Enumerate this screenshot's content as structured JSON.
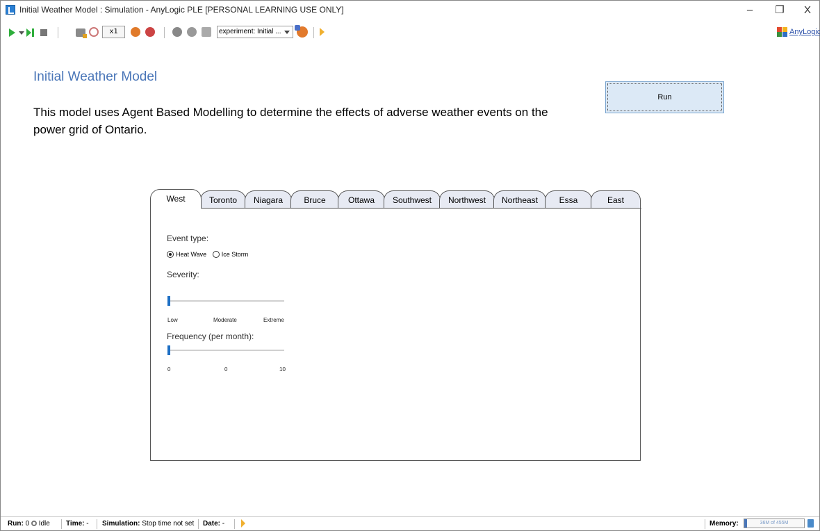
{
  "window": {
    "title": "Initial Weather Model : Simulation - AnyLogic PLE [PERSONAL LEARNING USE ONLY]",
    "controls": {
      "minimize": "–",
      "maximize": "❐",
      "close": "X"
    }
  },
  "toolbar": {
    "speed": "x1",
    "experiment_select": "experiment: Initial ...",
    "brand": "AnyLogic",
    "icons": [
      "play-icon",
      "dropdown-icon",
      "step-icon",
      "stop-icon",
      "model-icon",
      "time-icon",
      "slower-icon",
      "faster-icon",
      "camera-icon",
      "view-icon",
      "folder-icon",
      "experiment-icon",
      "run-arrow-icon"
    ]
  },
  "main": {
    "title": "Initial Weather Model",
    "description": "This model uses Agent Based Modelling to determine the effects of adverse weather events on the power grid of Ontario.",
    "run_button": "Run"
  },
  "tabs": [
    {
      "label": "West",
      "active": true
    },
    {
      "label": "Toronto"
    },
    {
      "label": "Niagara"
    },
    {
      "label": "Bruce"
    },
    {
      "label": "Ottawa"
    },
    {
      "label": "Southwest"
    },
    {
      "label": "Northwest"
    },
    {
      "label": "Northeast"
    },
    {
      "label": "Essa"
    },
    {
      "label": "East"
    }
  ],
  "panel": {
    "event_type_label": "Event type:",
    "event_options": [
      "Heat Wave",
      "Ice Storm"
    ],
    "event_selected": "Heat Wave",
    "severity_label": "Severity:",
    "severity_value": 0,
    "severity_ticks": [
      "Low",
      "Moderate",
      "Extreme"
    ],
    "frequency_label": "Frequency (per month):",
    "frequency_value": 0,
    "frequency_ticks": [
      "0",
      "0",
      "10"
    ]
  },
  "status": {
    "run_label": "Run:",
    "run_value": "0",
    "state": "Idle",
    "time_label": "Time:",
    "time_value": "-",
    "simulation_label": "Simulation:",
    "simulation_value": "Stop time not set",
    "date_label": "Date:",
    "date_value": "-",
    "memory_label": "Memory:",
    "memory_value": "36M of 455M"
  }
}
